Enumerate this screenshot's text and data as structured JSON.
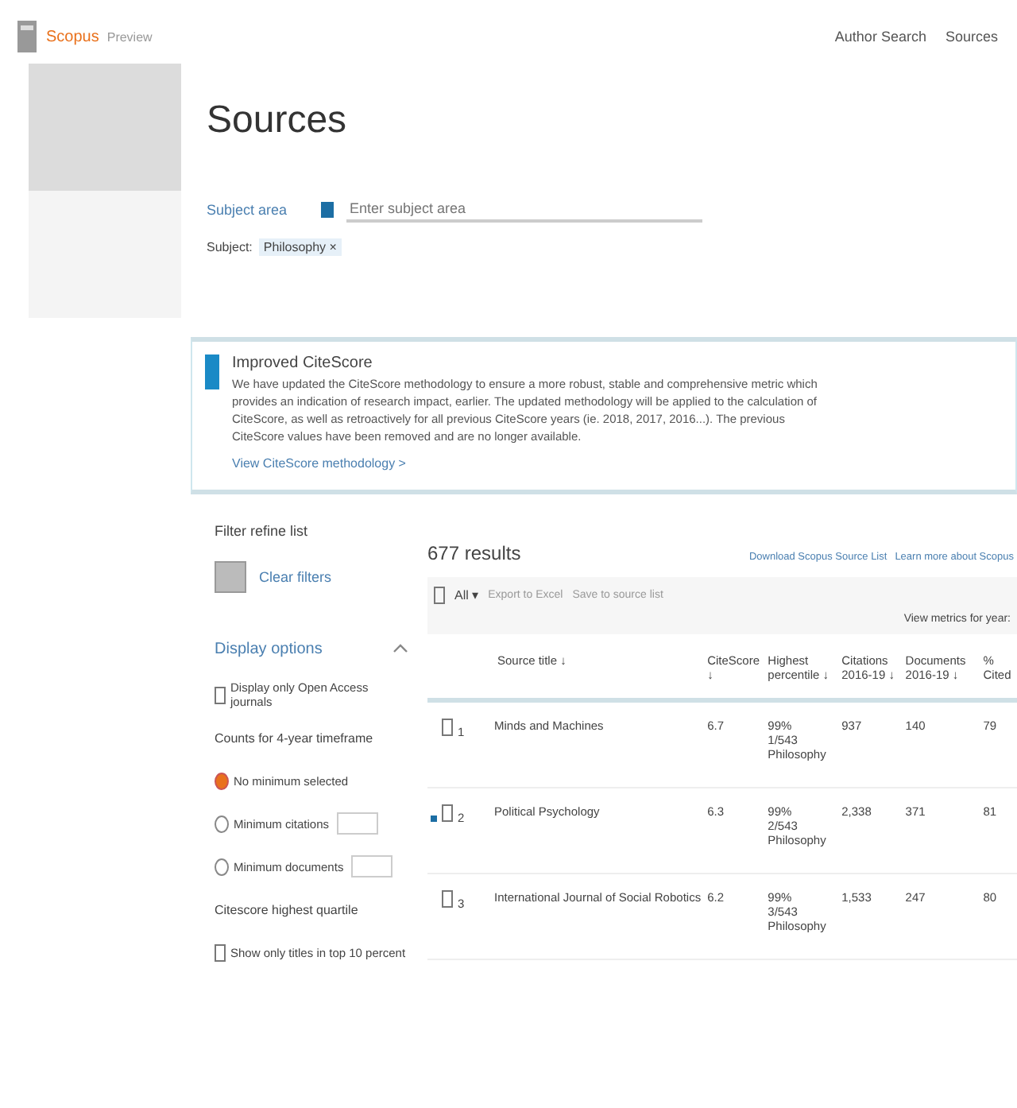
{
  "header": {
    "brand": "Scopus",
    "brand_sub": "Preview",
    "nav": [
      "Author Search",
      "Sources"
    ]
  },
  "page_title": "Sources",
  "subject_filter": {
    "label": "Subject area",
    "placeholder": "Enter subject area",
    "chip_label": "Subject:",
    "chip": "Philosophy ×"
  },
  "notice": {
    "title": "Improved CiteScore",
    "body": "We have updated the CiteScore methodology to ensure a more robust, stable and comprehensive metric which provides an indication of research impact, earlier. The updated methodology will be applied to the calculation of CiteScore, as well as retroactively for all previous CiteScore years (ie. 2018, 2017, 2016...). The previous CiteScore values have been removed and are no longer available.",
    "link": "View CiteScore methodology >"
  },
  "filters": {
    "title": "Filter refine list",
    "clear": "Clear filters",
    "section": "Display options",
    "expanded": true,
    "items": [
      {
        "kind": "checkbox",
        "label": "Display only Open Access journals",
        "checked": false
      },
      {
        "kind": "heading",
        "label": "Counts for 4-year timeframe"
      },
      {
        "kind": "radio",
        "label": "No minimum selected",
        "selected": true
      },
      {
        "kind": "radio",
        "label": "Minimum citations",
        "selected": false,
        "input": true
      },
      {
        "kind": "radio",
        "label": "Minimum documents",
        "selected": false,
        "input": true
      },
      {
        "kind": "heading",
        "label": "Citescore highest quartile"
      },
      {
        "kind": "checkbox",
        "label": "Show only titles in top 10 percent",
        "checked": false
      }
    ]
  },
  "results": {
    "count": "677 results",
    "links": [
      "Download Scopus Source List",
      "Learn more about Scopus"
    ],
    "toolbar": {
      "checked": false,
      "select_all": "All ▾",
      "actions": [
        "Export to Excel",
        "Save to source list"
      ],
      "year_label": "View metrics for year:"
    },
    "columns": [
      "Source title ↓",
      "CiteScore ↓",
      "Highest percentile ↓",
      "Citations 2016-19 ↓",
      "Documents 2016-19 ↓",
      "% Cited"
    ],
    "rows": [
      {
        "rank": "1",
        "title": "Minds and Machines",
        "citescore": "6.7",
        "percentile": [
          "99%",
          "1/543",
          "Philosophy"
        ],
        "citations": "937",
        "documents": "140",
        "cited": "79",
        "checked": false,
        "marked": false
      },
      {
        "rank": "2",
        "title": "Political Psychology",
        "citescore": "6.3",
        "percentile": [
          "99%",
          "2/543",
          "Philosophy"
        ],
        "citations": "2,338",
        "documents": "371",
        "cited": "81",
        "checked": false,
        "marked": true
      },
      {
        "rank": "3",
        "title": "International Journal of Social Robotics",
        "citescore": "6.2",
        "percentile": [
          "99%",
          "3/543",
          "Philosophy"
        ],
        "citations": "1,533",
        "documents": "247",
        "cited": "80",
        "checked": false,
        "marked": false
      }
    ]
  }
}
